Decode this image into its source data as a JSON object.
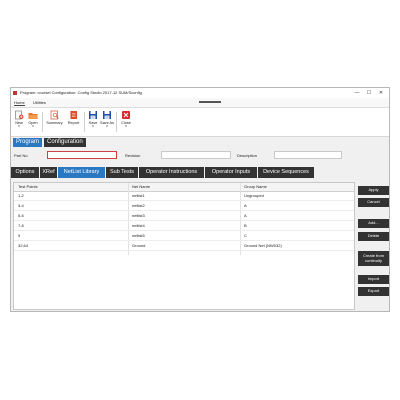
{
  "window": {
    "title": "Program: coursei    Configuration: Config Studio 2017-12 SUM/Sconfig",
    "minimize_glyph": "—",
    "maximize_glyph": "☐",
    "close_glyph": "✕"
  },
  "menu": {
    "home": "Home",
    "utilities": "Utilities"
  },
  "ribbon": {
    "new": "New",
    "open": "Open",
    "summary": "Summary",
    "report": "Report",
    "save": "Save",
    "save_as": "Save As",
    "close": "Close",
    "caret": "▾"
  },
  "top_tabs": {
    "program": "Program",
    "configuration": "Configuration"
  },
  "fields": {
    "part_no_label": "Part No",
    "part_no_value": "",
    "revision_label": "Revision",
    "revision_value": "",
    "description_label": "Description",
    "description_value": ""
  },
  "sub_tabs": [
    "Options",
    "XRef",
    "NetList Library",
    "Sub Tests",
    "Operator Instructions",
    "Operator Inputs",
    "Device Sequences"
  ],
  "active_sub_tab": "NetList Library",
  "table": {
    "headers": [
      "Test Points",
      "Net Name",
      "Group Name"
    ],
    "rows": [
      [
        "1-2",
        "netlist1",
        "Ungrouped"
      ],
      [
        "3-4",
        "netlist2",
        "A"
      ],
      [
        "5-6",
        "netlist3",
        "A"
      ],
      [
        "7-8",
        "netlist4",
        "B"
      ],
      [
        "9",
        "netlist5",
        "C"
      ],
      [
        "32,64",
        "Ground",
        "Ground Net (NW032)"
      ]
    ]
  },
  "side_buttons": {
    "apply": "Apply",
    "cancel": "Cancel",
    "add": "Add...",
    "delete": "Delete",
    "create_from_continuity": "Create from continuity",
    "import": "Import",
    "export": "Export"
  },
  "colors": {
    "accent_blue": "#2b78c2",
    "dark_tab": "#333333",
    "required_border": "#d04040"
  }
}
